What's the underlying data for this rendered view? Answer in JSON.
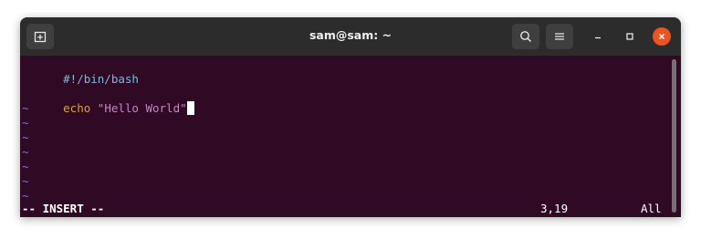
{
  "window": {
    "title": "sam@sam: ~"
  },
  "titlebar": {
    "new_tab_icon": "new-tab-icon",
    "search_icon": "search-icon",
    "menu_icon": "hamburger-menu-icon",
    "minimize_icon": "minimize-icon",
    "maximize_icon": "maximize-icon",
    "close_icon": "close-icon",
    "close_color": "#e95420"
  },
  "editor": {
    "lines": [
      {
        "shebang": "#!/bin/bash"
      },
      {
        "empty": ""
      },
      {
        "keyword": "echo",
        "string": "\"Hello World\""
      }
    ],
    "tildes": [
      "~",
      "~",
      "~",
      "~",
      "~",
      "~",
      "~"
    ],
    "background": "#300a24"
  },
  "statusline": {
    "mode": "-- INSERT --",
    "position": "3,19",
    "scope": "All"
  }
}
